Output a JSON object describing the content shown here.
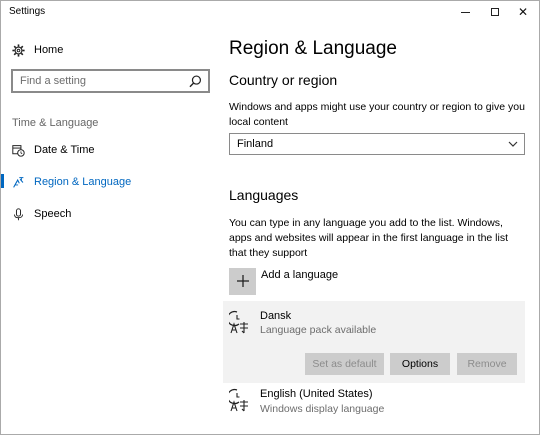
{
  "window": {
    "title": "Settings",
    "controls": {
      "minimize": "minimize-icon",
      "maximize": "maximize-icon",
      "close": "close-icon"
    }
  },
  "sidebar": {
    "home_label": "Home",
    "search_placeholder": "Find a setting",
    "section_label": "Time & Language",
    "items": [
      {
        "label": "Date & Time",
        "icon": "calendar-clock-icon",
        "selected": false
      },
      {
        "label": "Region & Language",
        "icon": "region-language-icon",
        "selected": true
      },
      {
        "label": "Speech",
        "icon": "microphone-icon",
        "selected": false
      }
    ]
  },
  "main": {
    "title": "Region & Language",
    "country_heading": "Country or region",
    "country_desc": "Windows and apps might use your country or region to give you local content",
    "country_value": "Finland",
    "languages_heading": "Languages",
    "languages_desc": "You can type in any language you add to the list. Windows, apps and websites will appear in the first language in the list that they support",
    "add_language_label": "Add a language",
    "languages": [
      {
        "name": "Dansk",
        "status": "Language pack available",
        "buttons": {
          "set_default": "Set as default",
          "options": "Options",
          "remove": "Remove"
        }
      },
      {
        "name": "English (United States)",
        "status": "Windows display language"
      }
    ]
  },
  "colors": {
    "accent": "#0067c0",
    "selected_card": "#f2f2f2",
    "button": "#cccccc"
  }
}
